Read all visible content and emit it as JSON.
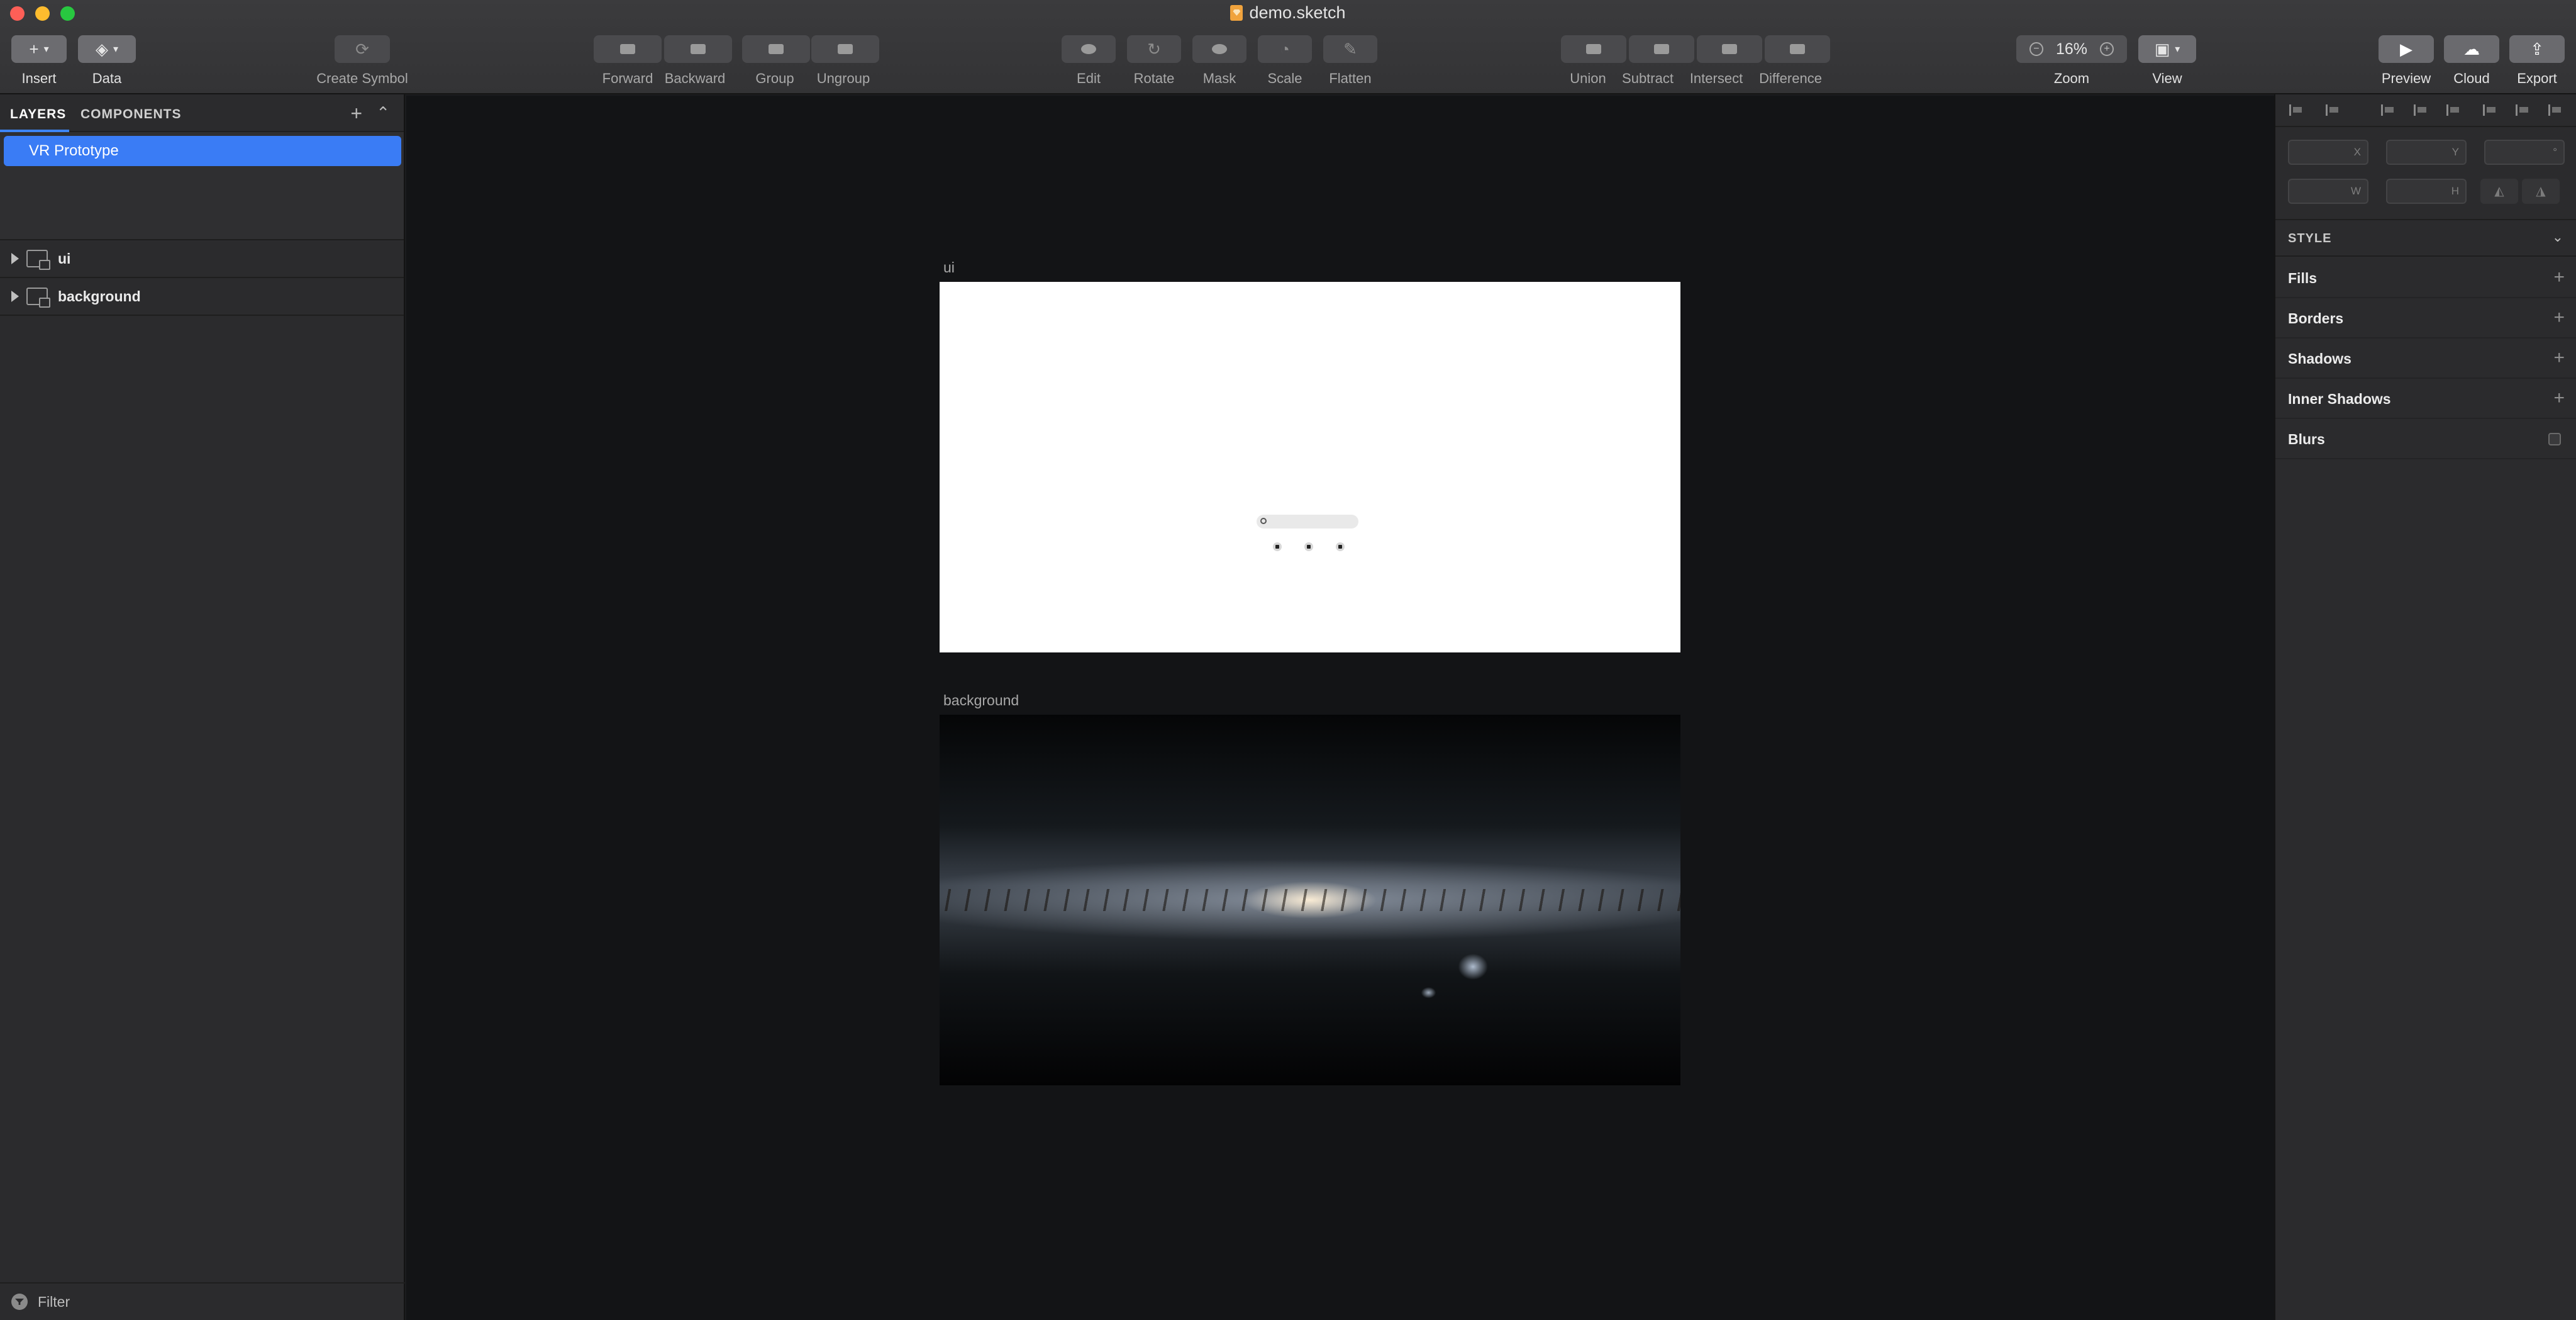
{
  "window": {
    "title": "demo.sketch"
  },
  "toolbar": {
    "insert_label": "Insert",
    "data_label": "Data",
    "create_symbol_label": "Create Symbol",
    "forward_label": "Forward",
    "backward_label": "Backward",
    "group_label": "Group",
    "ungroup_label": "Ungroup",
    "edit_label": "Edit",
    "rotate_label": "Rotate",
    "mask_label": "Mask",
    "scale_label": "Scale",
    "flatten_label": "Flatten",
    "union_label": "Union",
    "subtract_label": "Subtract",
    "intersect_label": "Intersect",
    "difference_label": "Difference",
    "zoom_value": "16%",
    "zoom_label": "Zoom",
    "view_label": "View",
    "preview_label": "Preview",
    "cloud_label": "Cloud",
    "export_label": "Export"
  },
  "layers_panel": {
    "tabs": [
      "LAYERS",
      "COMPONENTS"
    ],
    "pages": [
      "VR Prototype"
    ],
    "layers": [
      "ui",
      "background"
    ],
    "filter_label": "Filter"
  },
  "canvas": {
    "artboards": [
      "ui",
      "background"
    ]
  },
  "inspector": {
    "geometry": {
      "x": "X",
      "y": "Y",
      "w": "W",
      "h": "H",
      "rotation": "°"
    },
    "style_title": "STYLE",
    "sections": [
      "Fills",
      "Borders",
      "Shadows",
      "Inner Shadows",
      "Blurs"
    ]
  },
  "colors": {
    "selection_blue": "#3a7cf5",
    "canvas_bg": "#131416",
    "panel_bg": "#2b2b2d"
  }
}
